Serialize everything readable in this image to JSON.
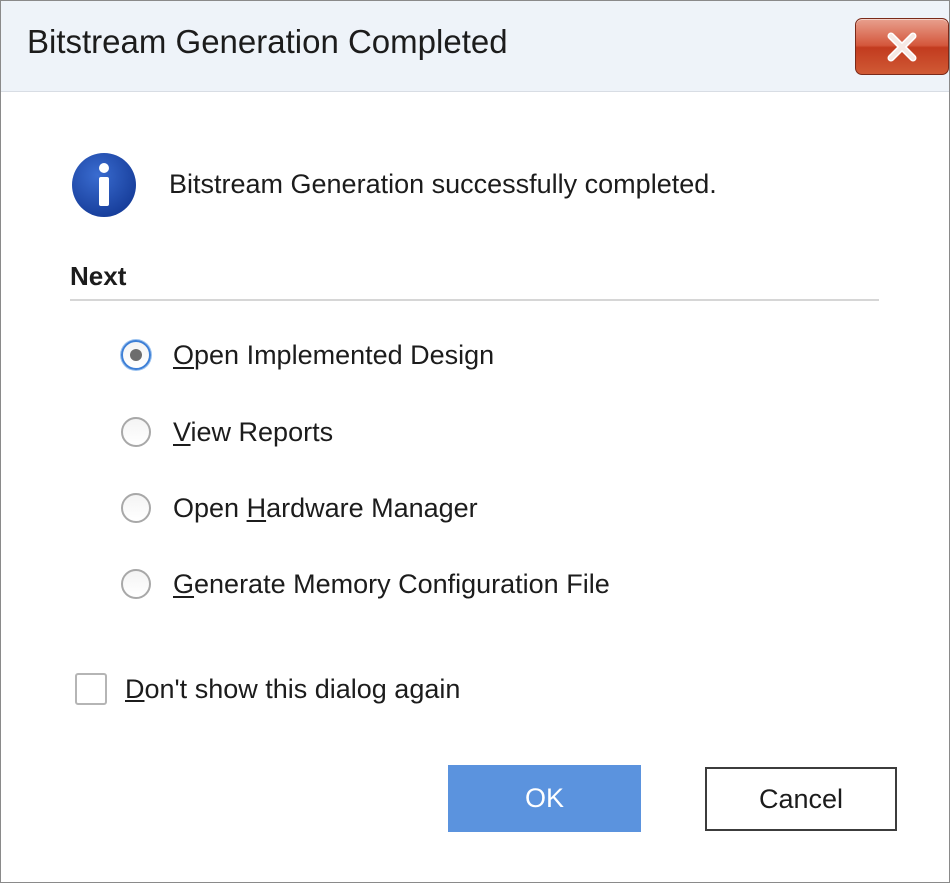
{
  "window": {
    "title": "Bitstream Generation Completed",
    "close_icon": "close-x-icon"
  },
  "message": {
    "icon": "info-icon",
    "text": "Bitstream Generation successfully completed."
  },
  "next": {
    "label": "Next",
    "options": [
      {
        "before": "",
        "mnemonic": "O",
        "after": "pen Implemented Design",
        "selected": true
      },
      {
        "before": "",
        "mnemonic": "V",
        "after": "iew Reports",
        "selected": false
      },
      {
        "before": "Open ",
        "mnemonic": "H",
        "after": "ardware Manager",
        "selected": false
      },
      {
        "before": "",
        "mnemonic": "G",
        "after": "enerate Memory Configuration File",
        "selected": false
      }
    ]
  },
  "dont_show": {
    "mnemonic": "D",
    "after": "on't show this dialog again",
    "checked": false
  },
  "buttons": {
    "ok": "OK",
    "cancel": "Cancel"
  },
  "colors": {
    "accent": "#5b93de",
    "info_icon": "#1e4fb0",
    "close_button": "#c94a2c"
  }
}
